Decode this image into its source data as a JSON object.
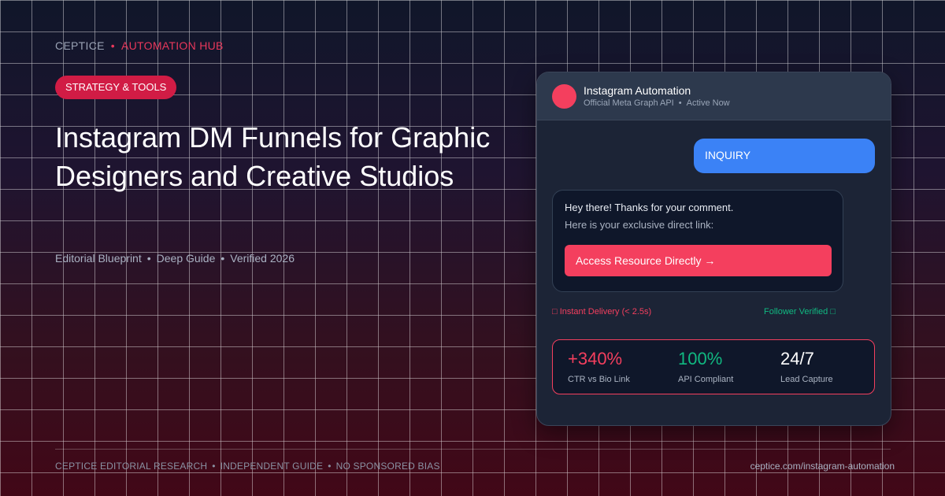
{
  "brand": {
    "name": "CEPTICE",
    "separator": "•",
    "section": "AUTOMATION HUB"
  },
  "category_pill": "STRATEGY & TOOLS",
  "headline": "Instagram DM Funnels for Graphic Designers and Creative Studios",
  "meta": {
    "items": [
      "Editorial Blueprint",
      "Deep Guide",
      "Verified 2026"
    ],
    "separator": "•"
  },
  "chat_card": {
    "header": {
      "title": "Instagram Automation",
      "subtitle_parts": [
        "Official Meta Graph API",
        "Active Now"
      ],
      "separator": "•"
    },
    "outgoing_message": "INQUIRY",
    "reply": {
      "line1": "Hey there! Thanks for your comment.",
      "line2": "Here is your exclusive direct link:",
      "button_label": "Access Resource Directly →"
    },
    "status_left": "□ Instant Delivery (< 2.5s)",
    "status_right": "Follower Verified □",
    "stats": [
      {
        "value": "+340%",
        "label": "CTR vs Bio Link"
      },
      {
        "value": "100%",
        "label": "API Compliant"
      },
      {
        "value": "24/7",
        "label": "Lead Capture"
      }
    ]
  },
  "footer": {
    "left_parts": [
      "CEPTICE EDITORIAL RESEARCH",
      "INDEPENDENT GUIDE",
      "NO SPONSORED BIAS"
    ],
    "separator": "•",
    "right": "ceptice.com/instagram-automation"
  },
  "colors": {
    "accent": "#f43f5e",
    "pill": "#d11c45",
    "outgoing_bubble": "#3b82f6",
    "success": "#10b981",
    "card_bg": "#1c2436"
  }
}
